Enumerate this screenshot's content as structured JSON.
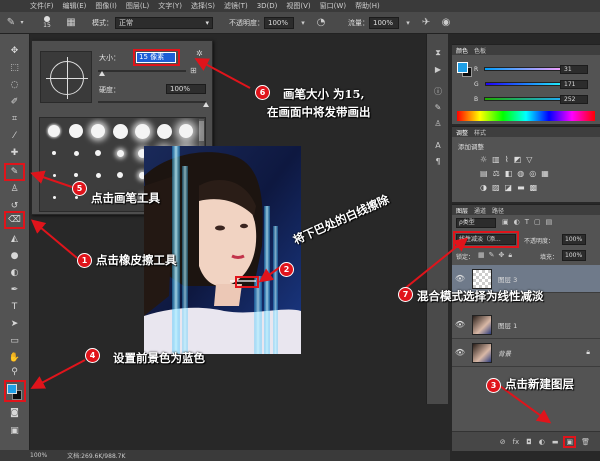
{
  "menu": [
    "文件(F)",
    "编辑(E)",
    "图像(I)",
    "图层(L)",
    "文字(Y)",
    "选择(S)",
    "滤镜(T)",
    "3D(D)",
    "视图(V)",
    "窗口(W)",
    "帮助(H)"
  ],
  "options": {
    "brush_size": "15",
    "mode_label": "模式：",
    "mode_value": "正常",
    "opacity_label": "不透明度：",
    "opacity_value": "100%",
    "flow_label": "流量：",
    "flow_value": "100%"
  },
  "brush_panel": {
    "size_label": "大小：",
    "size_value": "15 像素",
    "hardness_label": "硬度：",
    "hardness_value": "100%",
    "size_slider": 0.05,
    "hardness_slider": 1.0
  },
  "colors": {
    "foreground": "#1f9fe6",
    "background": "#0d0d0d",
    "accent_red": "#e0141b"
  },
  "color_panel": {
    "tabs": [
      "颜色",
      "色板"
    ],
    "r_label": "R",
    "r_value": "31",
    "g_label": "G",
    "g_value": "171",
    "b_label": "B",
    "b_value": "252"
  },
  "adjust_panel": {
    "tabs": [
      "调整",
      "样式"
    ],
    "title": "添加调整"
  },
  "layers_panel": {
    "tabs": [
      "图层",
      "通道",
      "路径"
    ],
    "kind_label": "ρ类型",
    "blend_mode": "线性减淡（添...",
    "opacity_label": "不透明度：",
    "opacity_value": "100%",
    "lock_label": "锁定：",
    "fill_label": "填充：",
    "fill_value": "100%",
    "layers": [
      {
        "name": "图层 3",
        "selected": true
      },
      {
        "name": "图层 1",
        "selected": false
      },
      {
        "name": "背景",
        "selected": false
      }
    ]
  },
  "status": {
    "zoom": "100%",
    "doc": "文档:269.6K/988.7K"
  },
  "annotations": [
    {
      "num": "1",
      "text": "点击橡皮擦工具"
    },
    {
      "num": "2",
      "text": "将下巴处的白线擦除"
    },
    {
      "num": "3",
      "text": "点击新建图层"
    },
    {
      "num": "4",
      "text": "设置前景色为蓝色"
    },
    {
      "num": "5",
      "text": "点击画笔工具"
    },
    {
      "num": "6",
      "text": "画笔大小 为15,"
    },
    {
      "num": "6b",
      "text": "在画面中将发带画出"
    },
    {
      "num": "7",
      "text": "混合模式选择为线性减淡"
    }
  ]
}
